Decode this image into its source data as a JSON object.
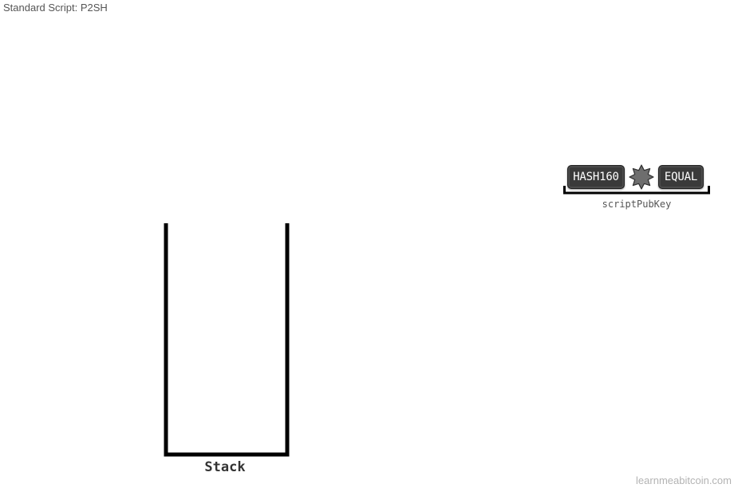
{
  "page": {
    "title": "Standard Script: P2SH"
  },
  "script_pubkey": {
    "label": "scriptPubKey",
    "opcodes": [
      {
        "label": "HASH160",
        "icon": "none"
      },
      {
        "label": "",
        "icon": "hash-placeholder-starburst-icon"
      },
      {
        "label": "EQUAL",
        "icon": "none"
      }
    ]
  },
  "stack": {
    "label": "Stack",
    "items": []
  },
  "footer": {
    "watermark": "learnmeabitcoin.com"
  },
  "colors": {
    "opcode_bg": "#3a3a3a",
    "placeholder_fill": "#6e6e6e",
    "stack_stroke": "#000000",
    "label_text": "#555555",
    "watermark_text": "#b3b3b3"
  }
}
